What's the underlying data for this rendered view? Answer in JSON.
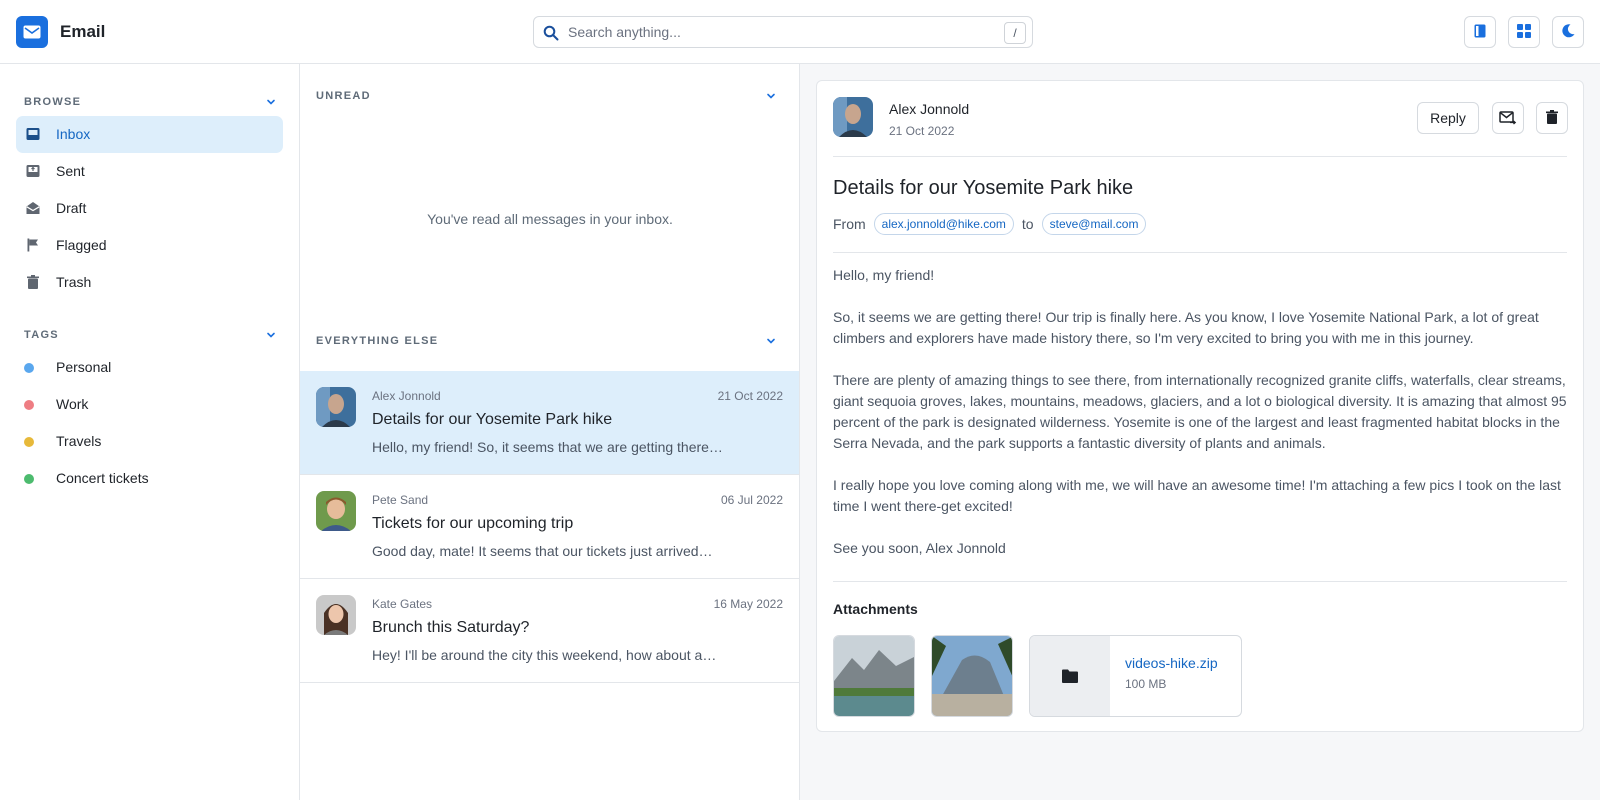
{
  "app": {
    "title": "Email"
  },
  "search": {
    "placeholder": "Search anything...",
    "shortcut": "/"
  },
  "header_buttons": [
    {
      "icon": "bookmark-icon"
    },
    {
      "icon": "grid-icon"
    },
    {
      "icon": "moon-icon"
    }
  ],
  "sidebar": {
    "browse_label": "BROWSE",
    "items": [
      {
        "label": "Inbox",
        "icon": "inbox-icon",
        "active": true
      },
      {
        "label": "Sent",
        "icon": "sent-icon"
      },
      {
        "label": "Draft",
        "icon": "draft-icon"
      },
      {
        "label": "Flagged",
        "icon": "flag-icon"
      },
      {
        "label": "Trash",
        "icon": "trash-icon"
      }
    ],
    "tags_label": "TAGS",
    "tags": [
      {
        "label": "Personal",
        "color": "#5aa7ee"
      },
      {
        "label": "Work",
        "color": "#ee7d83"
      },
      {
        "label": "Travels",
        "color": "#e7b93a"
      },
      {
        "label": "Concert tickets",
        "color": "#4cbb6e"
      }
    ]
  },
  "list": {
    "unread_label": "UNREAD",
    "empty_text": "You've read all messages in your inbox.",
    "else_label": "EVERYTHING ELSE",
    "messages": [
      {
        "from": "Alex Jonnold",
        "date": "21 Oct 2022",
        "subject": "Details for our Yosemite Park hike",
        "preview": "Hello, my friend! So, it seems that we are getting there…",
        "active": true
      },
      {
        "from": "Pete Sand",
        "date": "06 Jul 2022",
        "subject": "Tickets for our upcoming trip",
        "preview": "Good day, mate! It seems that our tickets just arrived…"
      },
      {
        "from": "Kate Gates",
        "date": "16 May 2022",
        "subject": "Brunch this Saturday?",
        "preview": "Hey! I'll be around the city this weekend, how about a…"
      }
    ]
  },
  "reader": {
    "sender": "Alex Jonnold",
    "date": "21 Oct 2022",
    "reply_label": "Reply",
    "subject": "Details for our Yosemite Park hike",
    "from_label": "From",
    "from_email": "alex.jonnold@hike.com",
    "to_label": "to",
    "to_email": "steve@mail.com",
    "body": [
      "Hello, my friend!",
      "So, it seems we are getting there! Our trip is finally here. As you know, I love Yosemite National Park, a lot of great climbers and explorers have made history there, so I'm very excited to bring you with me in this journey.",
      "There are plenty of amazing things to see there, from internationally recognized granite cliffs, waterfalls, clear streams, giant sequoia groves, lakes, mountains, meadows, glaciers, and a lot o biological diversity. It is amazing that almost 95 percent of the park is designated wilderness. Yosemite is one of the largest and least fragmented habitat blocks in the Serra Nevada, and the park supports a fantastic diversity of plants and animals.",
      "I really hope you love coming along with me, we will have an awesome time! I'm attaching a few pics I took on the last time I went there-get excited!",
      "See you soon, Alex Jonnold"
    ],
    "attachments_label": "Attachments",
    "file": {
      "name": "videos-hike.zip",
      "size": "100 MB"
    }
  },
  "colors": {
    "accent": "#1a6fde",
    "active_bg": "#ddeefb",
    "link": "#1567c3"
  }
}
